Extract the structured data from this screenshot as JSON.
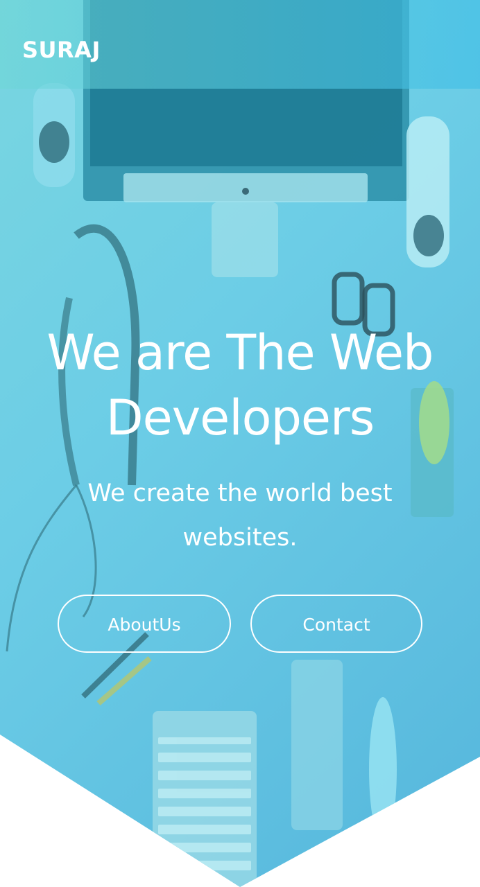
{
  "navbar": {
    "brand": "SURAJ"
  },
  "hero": {
    "headline_line1": "We are The Web",
    "headline_line2": "Developers",
    "tagline_line1": "We create the world best",
    "tagline_line2": "websites.",
    "buttons": {
      "about": "AboutUs",
      "contact": "Contact"
    }
  },
  "colors": {
    "overlay_start": "#79d6e0",
    "overlay_end": "#55b6dc",
    "text": "#ffffff"
  }
}
